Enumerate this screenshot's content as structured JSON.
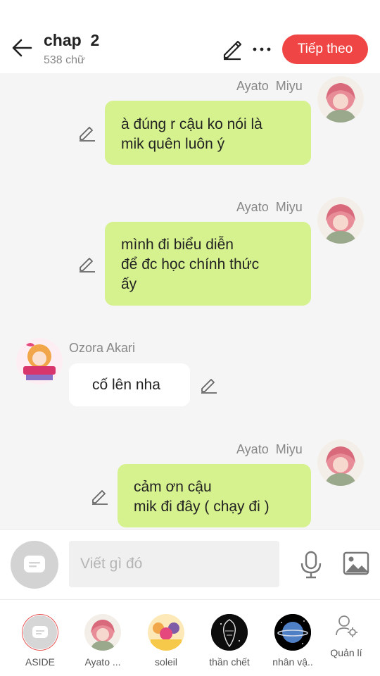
{
  "header": {
    "title": "chap  2",
    "subtitle": "538 chữ",
    "next_label": "Tiếp theo"
  },
  "messages": [
    {
      "sender": "Ayato  Miyu",
      "side": "right",
      "lines": [
        "à đúng r cậu ko nói là",
        "mik quên luôn ý"
      ]
    },
    {
      "sender": "Ayato  Miyu",
      "side": "right",
      "lines": [
        "mình đi biểu diễn",
        "để đc học chính thức",
        "ấy"
      ]
    },
    {
      "sender": "Ozora Akari",
      "side": "left",
      "lines": [
        "cố lên nha"
      ]
    },
    {
      "sender": "Ayato  Miyu",
      "side": "right",
      "lines": [
        "cảm ơn cậu",
        "mik đi đây ( chạy đi )"
      ]
    }
  ],
  "composer": {
    "placeholder": "Viết gì đó"
  },
  "bottom_tabs": [
    {
      "label": "ASIDE"
    },
    {
      "label": "Ayato ..."
    },
    {
      "label": "soleil"
    },
    {
      "label": "thần chết"
    },
    {
      "label": "nhân vậ.."
    },
    {
      "label": "Quản lí"
    }
  ],
  "colors": {
    "accent": "#f04545",
    "bubble_green": "#d6f28e",
    "background": "#f5f5f5"
  }
}
